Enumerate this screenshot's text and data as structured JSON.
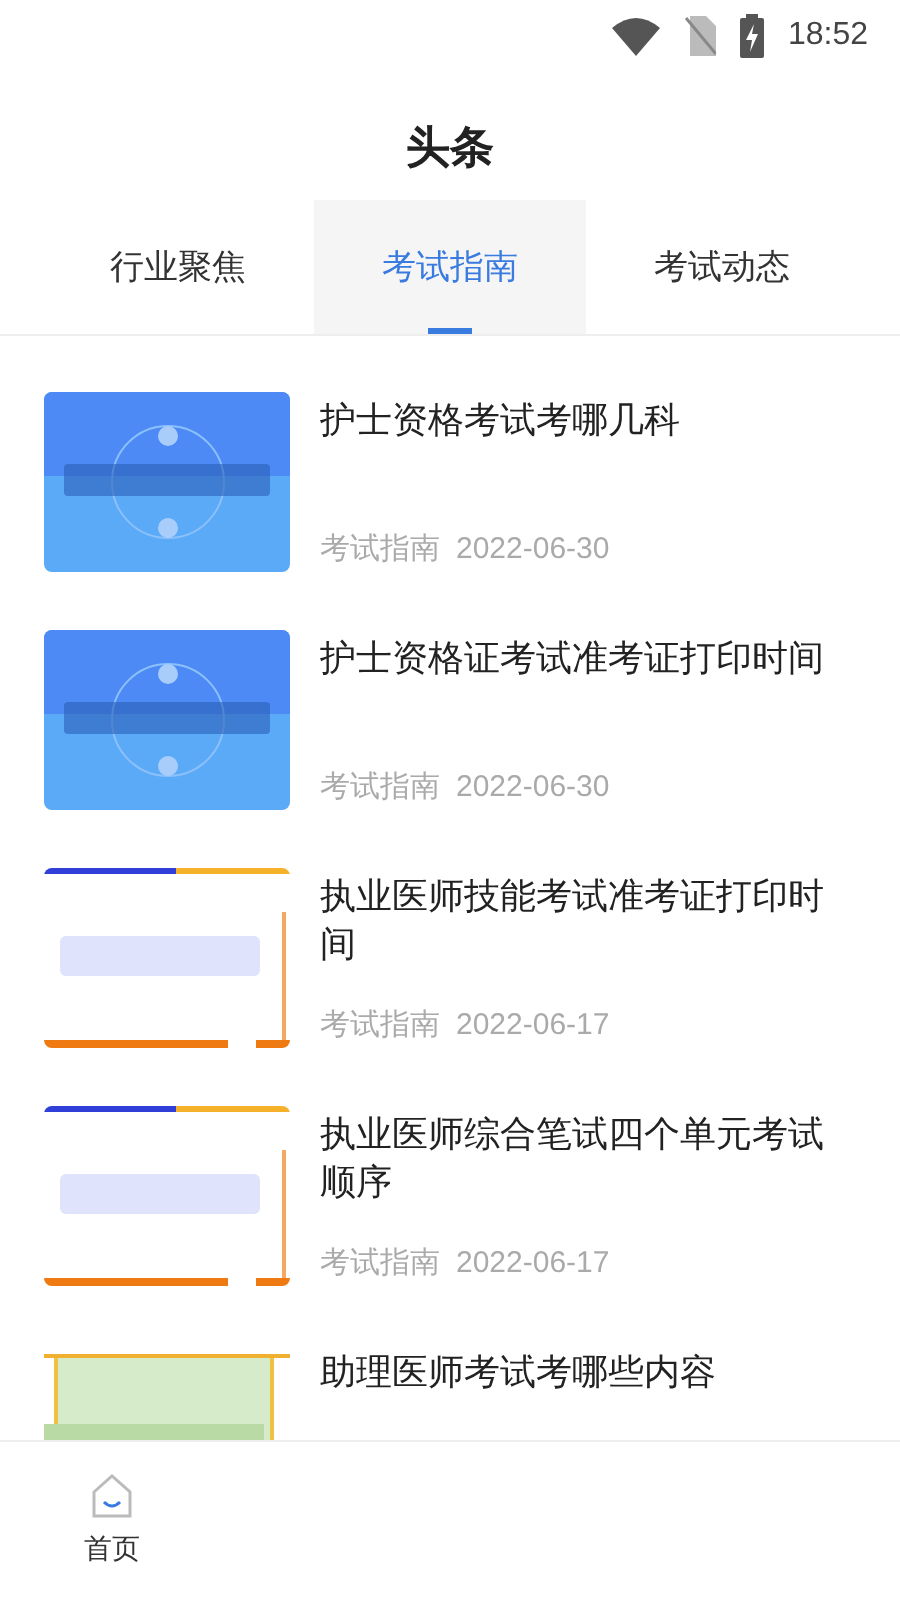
{
  "status_bar": {
    "time": "18:52"
  },
  "header": {
    "title": "头条"
  },
  "tabs": [
    {
      "label": "行业聚焦",
      "selected": false
    },
    {
      "label": "考试指南",
      "selected": true
    },
    {
      "label": "考试动态",
      "selected": false
    }
  ],
  "articles": [
    {
      "title": "护士资格考试考哪几科",
      "category": "考试指南",
      "date": "2022-06-30"
    },
    {
      "title": "护士资格证考试准考证打印时间",
      "category": "考试指南",
      "date": "2022-06-30"
    },
    {
      "title": "执业医师技能考试准考证打印时间",
      "category": "考试指南",
      "date": "2022-06-17"
    },
    {
      "title": "执业医师综合笔试四个单元考试顺序",
      "category": "考试指南",
      "date": "2022-06-17"
    },
    {
      "title": "助理医师考试考哪些内容"
    }
  ],
  "bottom_nav": [
    {
      "label": "首页",
      "selected": true
    }
  ]
}
